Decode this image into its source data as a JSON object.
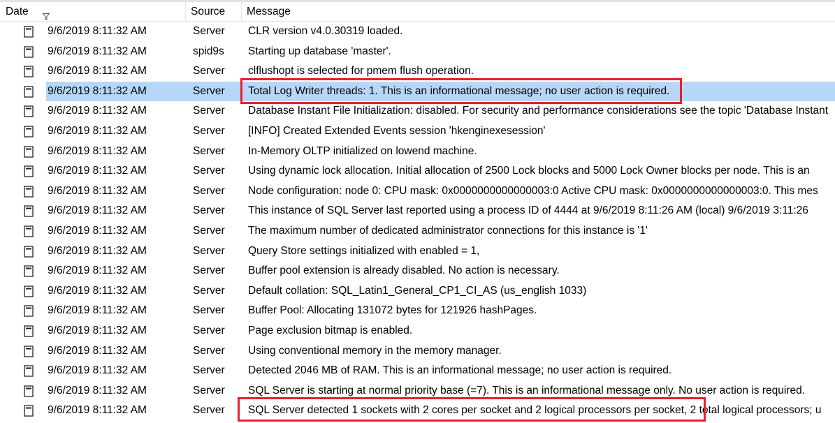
{
  "header": {
    "date_label": "Date",
    "source_label": "Source",
    "message_label": "Message"
  },
  "rows": [
    {
      "date": "9/6/2019 8:11:32 AM",
      "source": "Server",
      "message": "CLR version v4.0.30319 loaded."
    },
    {
      "date": "9/6/2019 8:11:32 AM",
      "source": "spid9s",
      "message": "Starting up database 'master'."
    },
    {
      "date": "9/6/2019 8:11:32 AM",
      "source": "Server",
      "message": "clflushopt is selected for pmem flush operation."
    },
    {
      "date": "9/6/2019 8:11:32 AM",
      "source": "Server",
      "message": "Total Log Writer threads: 1. This is an informational message; no user action is required."
    },
    {
      "date": "9/6/2019 8:11:32 AM",
      "source": "Server",
      "message": "Database Instant File Initialization: disabled. For security and performance considerations see the topic 'Database Instant"
    },
    {
      "date": "9/6/2019 8:11:32 AM",
      "source": "Server",
      "message": "[INFO] Created Extended Events session 'hkenginexesession'"
    },
    {
      "date": "9/6/2019 8:11:32 AM",
      "source": "Server",
      "message": "In-Memory OLTP initialized on lowend machine."
    },
    {
      "date": "9/6/2019 8:11:32 AM",
      "source": "Server",
      "message": "Using dynamic lock allocation.  Initial allocation of 2500 Lock blocks and 5000 Lock Owner blocks per node.  This is an"
    },
    {
      "date": "9/6/2019 8:11:32 AM",
      "source": "Server",
      "message": "Node configuration: node 0: CPU mask: 0x0000000000000003:0 Active CPU mask: 0x0000000000000003:0. This mes"
    },
    {
      "date": "9/6/2019 8:11:32 AM",
      "source": "Server",
      "message": "This instance of SQL Server last reported using a process ID of 4444 at 9/6/2019 8:11:26 AM (local) 9/6/2019 3:11:26"
    },
    {
      "date": "9/6/2019 8:11:32 AM",
      "source": "Server",
      "message": "The maximum number of dedicated administrator connections for this instance is '1'"
    },
    {
      "date": "9/6/2019 8:11:32 AM",
      "source": "Server",
      "message": "Query Store settings initialized with enabled = 1,"
    },
    {
      "date": "9/6/2019 8:11:32 AM",
      "source": "Server",
      "message": "Buffer pool extension is already disabled. No action is necessary."
    },
    {
      "date": "9/6/2019 8:11:32 AM",
      "source": "Server",
      "message": "Default collation: SQL_Latin1_General_CP1_CI_AS (us_english 1033)"
    },
    {
      "date": "9/6/2019 8:11:32 AM",
      "source": "Server",
      "message": "Buffer Pool: Allocating 131072 bytes for 121926 hashPages."
    },
    {
      "date": "9/6/2019 8:11:32 AM",
      "source": "Server",
      "message": "Page exclusion bitmap is enabled."
    },
    {
      "date": "9/6/2019 8:11:32 AM",
      "source": "Server",
      "message": "Using conventional memory in the memory manager."
    },
    {
      "date": "9/6/2019 8:11:32 AM",
      "source": "Server",
      "message": "Detected 2046 MB of RAM. This is an informational message; no user action is required."
    },
    {
      "date": "9/6/2019 8:11:32 AM",
      "source": "Server",
      "message": "SQL Server is starting at normal priority base (=7). This is an informational message only. No user action is required."
    },
    {
      "date": "9/6/2019 8:11:32 AM",
      "source": "Server",
      "message": "SQL Server detected 1 sockets with 2 cores per socket and 2 logical processors per socket, 2 total logical processors; u"
    }
  ],
  "selected_row": 3,
  "highlight_color": "#e8202a",
  "selection_color": "#b6d7f8",
  "icons": {
    "row": "log-entry-icon",
    "filter": "filter-icon"
  }
}
